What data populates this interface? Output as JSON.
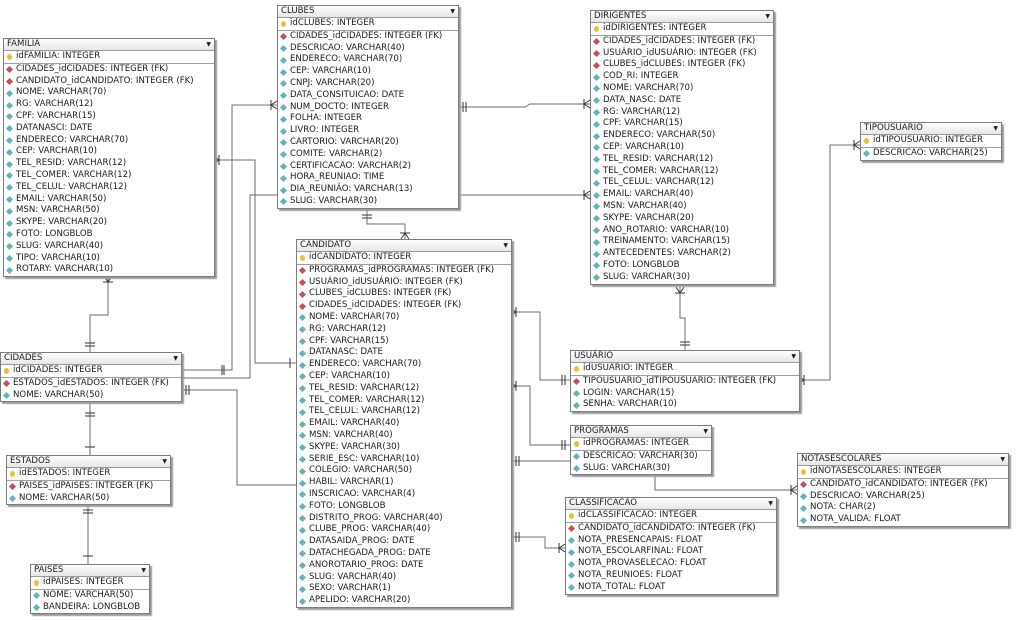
{
  "colors": {
    "primary_key": "#e3c23c",
    "foreign_key": "#c2505a",
    "column": "#69b1b8",
    "line": "#6e6e6e"
  },
  "tables": [
    {
      "id": "familia",
      "name": "FAMILIA",
      "fields": [
        {
          "text": "idFAMILIA: INTEGER",
          "key": "pk"
        },
        {
          "text": "CIDADES_idCIDADES: INTEGER (FK)",
          "key": "fk"
        },
        {
          "text": "CANDIDATO_idCANDIDATO: INTEGER (FK)",
          "key": "fk"
        },
        {
          "text": "NOME: VARCHAR(70)",
          "key": "col"
        },
        {
          "text": "RG: VARCHAR(12)",
          "key": "col"
        },
        {
          "text": "CPF: VARCHAR(15)",
          "key": "col"
        },
        {
          "text": "DATANASCI: DATE",
          "key": "col"
        },
        {
          "text": "ENDERECO: VARCHAR(70)",
          "key": "col"
        },
        {
          "text": "CEP: VARCHAR(10)",
          "key": "col"
        },
        {
          "text": "TEL_RESID: VARCHAR(12)",
          "key": "col"
        },
        {
          "text": "TEL_COMER: VARCHAR(12)",
          "key": "col"
        },
        {
          "text": "TEL_CELUL: VARCHAR(12)",
          "key": "col"
        },
        {
          "text": "EMAIL: VARCHAR(50)",
          "key": "col"
        },
        {
          "text": "MSN: VARCHAR(50)",
          "key": "col"
        },
        {
          "text": "SKYPE: VARCHAR(20)",
          "key": "col"
        },
        {
          "text": "FOTO: LONGBLOB",
          "key": "col"
        },
        {
          "text": "SLUG: VARCHAR(40)",
          "key": "col"
        },
        {
          "text": "TIPO: VARCHAR(10)",
          "key": "col"
        },
        {
          "text": "ROTARY: VARCHAR(10)",
          "key": "col"
        }
      ]
    },
    {
      "id": "clubes",
      "name": "CLUBES",
      "fields": [
        {
          "text": "idCLUBES: INTEGER",
          "key": "pk"
        },
        {
          "text": "CIDADES_idCIDADES: INTEGER (FK)",
          "key": "fk"
        },
        {
          "text": "DESCRICAO: VARCHAR(40)",
          "key": "col"
        },
        {
          "text": "ENDERECO: VARCHAR(70)",
          "key": "col"
        },
        {
          "text": "CEP: VARCHAR(10)",
          "key": "col"
        },
        {
          "text": "CNPJ: VARCHAR(20)",
          "key": "col"
        },
        {
          "text": "DATA_CONSITUICAO: DATE",
          "key": "col"
        },
        {
          "text": "NUM_DOCTO: INTEGER",
          "key": "col"
        },
        {
          "text": "FOLHA: INTEGER",
          "key": "col"
        },
        {
          "text": "LIVRO: INTEGER",
          "key": "col"
        },
        {
          "text": "CARTORIO: VARCHAR(20)",
          "key": "col"
        },
        {
          "text": "COMITE: VARCHAR(2)",
          "key": "col"
        },
        {
          "text": "CERTIFICACAO: VARCHAR(2)",
          "key": "col"
        },
        {
          "text": "HORA_REUNIAO: TIME",
          "key": "col"
        },
        {
          "text": "DIA_REUNIÃO: VARCHAR(13)",
          "key": "col"
        },
        {
          "text": "SLUG: VARCHAR(30)",
          "key": "col"
        }
      ]
    },
    {
      "id": "dirigentes",
      "name": "DIRIGENTES",
      "fields": [
        {
          "text": "idDIRIGENTES: INTEGER",
          "key": "pk"
        },
        {
          "text": "CIDADES_idCIDADES: INTEGER (FK)",
          "key": "fk"
        },
        {
          "text": "USUÁRIO_idUSUÁRIO: INTEGER (FK)",
          "key": "fk"
        },
        {
          "text": "CLUBES_idCLUBES: INTEGER (FK)",
          "key": "fk"
        },
        {
          "text": "COD_RI: INTEGER",
          "key": "col"
        },
        {
          "text": "NOME: VARCHAR(70)",
          "key": "col"
        },
        {
          "text": "DATA_NASC: DATE",
          "key": "col"
        },
        {
          "text": "RG: VARCHAR(12)",
          "key": "col"
        },
        {
          "text": "CPF: VARCHAR(15)",
          "key": "col"
        },
        {
          "text": "ENDERECO: VARCHAR(50)",
          "key": "col"
        },
        {
          "text": "CEP: VARCHAR(10)",
          "key": "col"
        },
        {
          "text": "TEL_RESID: VARCHAR(12)",
          "key": "col"
        },
        {
          "text": "TEL_COMER: VARCHAR(12)",
          "key": "col"
        },
        {
          "text": "TEL_CELUL: VARCHAR(12)",
          "key": "col"
        },
        {
          "text": "EMAIL: VARCHAR(40)",
          "key": "col"
        },
        {
          "text": "MSN: VARCHAR(40)",
          "key": "col"
        },
        {
          "text": "SKYPE: VARCHAR(20)",
          "key": "col"
        },
        {
          "text": "ANO_ROTARIO: VARCHAR(10)",
          "key": "col"
        },
        {
          "text": "TREINAMENTO: VARCHAR(15)",
          "key": "col"
        },
        {
          "text": "ANTECEDENTES: VARCHAR(2)",
          "key": "col"
        },
        {
          "text": "FOTO: LONGBLOB",
          "key": "col"
        },
        {
          "text": "SLUG: VARCHAR(30)",
          "key": "col"
        }
      ]
    },
    {
      "id": "tipousuario",
      "name": "TIPOUSUARIO",
      "fields": [
        {
          "text": "idTIPOUSUARIO: INTEGER",
          "key": "pk"
        },
        {
          "text": "DESCRICAO: VARCHAR(25)",
          "key": "col"
        }
      ]
    },
    {
      "id": "candidato",
      "name": "CANDIDATO",
      "fields": [
        {
          "text": "idCANDIDATO: INTEGER",
          "key": "pk"
        },
        {
          "text": "PROGRAMAS_idPROGRAMAS: INTEGER (FK)",
          "key": "fk"
        },
        {
          "text": "USUÁRIO_idUSUÁRIO: INTEGER (FK)",
          "key": "fk"
        },
        {
          "text": "CLUBES_idCLUBES: INTEGER (FK)",
          "key": "fk"
        },
        {
          "text": "CIDADES_idCIDADES: INTEGER (FK)",
          "key": "fk"
        },
        {
          "text": "NOME: VARCHAR(70)",
          "key": "col"
        },
        {
          "text": "RG: VARCHAR(12)",
          "key": "col"
        },
        {
          "text": "CPF: VARCHAR(15)",
          "key": "col"
        },
        {
          "text": "DATANASC: DATE",
          "key": "col"
        },
        {
          "text": "ENDERECO: VARCHAR(70)",
          "key": "col"
        },
        {
          "text": "CEP: VARCHAR(10)",
          "key": "col"
        },
        {
          "text": "TEL_RESID: VARCHAR(12)",
          "key": "col"
        },
        {
          "text": "TEL_COMER: VARCHAR(12)",
          "key": "col"
        },
        {
          "text": "TEL_CELUL: VARCHAR(12)",
          "key": "col"
        },
        {
          "text": "EMAIL: VARCHAR(40)",
          "key": "col"
        },
        {
          "text": "MSN: VARCHAR(40)",
          "key": "col"
        },
        {
          "text": "SKYPE: VARCHAR(30)",
          "key": "col"
        },
        {
          "text": "SERIE_ESC: VARCHAR(10)",
          "key": "col"
        },
        {
          "text": "COLEGIO: VARCHAR(50)",
          "key": "col"
        },
        {
          "text": "HABIL: VARCHAR(1)",
          "key": "col"
        },
        {
          "text": "INSCRICAO: VARCHAR(4)",
          "key": "col"
        },
        {
          "text": "FOTO: LONGBLOB",
          "key": "col"
        },
        {
          "text": "DISTRITO_PROG: VARCHAR(40)",
          "key": "col"
        },
        {
          "text": "CLUBE_PROG: VARCHAR(40)",
          "key": "col"
        },
        {
          "text": "DATASAIDA_PROG: DATE",
          "key": "col"
        },
        {
          "text": "DATACHEGADA_PROG: DATE",
          "key": "col"
        },
        {
          "text": "ANOROTARIO_PROG: DATE",
          "key": "col"
        },
        {
          "text": "SLUG: VARCHAR(40)",
          "key": "col"
        },
        {
          "text": "SEXO: VARCHAR(1)",
          "key": "col"
        },
        {
          "text": "APELIDO: VARCHAR(20)",
          "key": "col"
        }
      ]
    },
    {
      "id": "cidades",
      "name": "CIDADES",
      "fields": [
        {
          "text": "idCIDADES: INTEGER",
          "key": "pk"
        },
        {
          "text": "ESTADOS_idESTADOS: INTEGER (FK)",
          "key": "fk"
        },
        {
          "text": "NOME: VARCHAR(50)",
          "key": "col"
        }
      ]
    },
    {
      "id": "estados",
      "name": "ESTADOS",
      "fields": [
        {
          "text": "idESTADOS: INTEGER",
          "key": "pk"
        },
        {
          "text": "PAISES_idPAISES: INTEGER (FK)",
          "key": "fk"
        },
        {
          "text": "NOME: VARCHAR(50)",
          "key": "col"
        }
      ]
    },
    {
      "id": "paises",
      "name": "PAISES",
      "fields": [
        {
          "text": "idPAISES: INTEGER",
          "key": "pk"
        },
        {
          "text": "NOME: VARCHAR(50)",
          "key": "col"
        },
        {
          "text": "BANDEIRA: LONGBLOB",
          "key": "col"
        }
      ]
    },
    {
      "id": "usuario",
      "name": "USUÁRIO",
      "fields": [
        {
          "text": "idUSUÁRIO: INTEGER",
          "key": "pk"
        },
        {
          "text": "TIPOUSUARIO_idTIPOUSUARIO: INTEGER (FK)",
          "key": "fk"
        },
        {
          "text": "LOGIN: VARCHAR(15)",
          "key": "col"
        },
        {
          "text": "SENHA: VARCHAR(10)",
          "key": "col"
        }
      ]
    },
    {
      "id": "programas",
      "name": "PROGRAMAS",
      "fields": [
        {
          "text": "idPROGRAMAS: INTEGER",
          "key": "pk"
        },
        {
          "text": "DESCRICAO: VARCHAR(30)",
          "key": "col"
        },
        {
          "text": "SLUG: VARCHAR(30)",
          "key": "col"
        }
      ]
    },
    {
      "id": "notasescolares",
      "name": "NOTASESCOLARES",
      "fields": [
        {
          "text": "idNOTASESCOLARES: INTEGER",
          "key": "pk"
        },
        {
          "text": "CANDIDATO_idCANDIDATO: INTEGER (FK)",
          "key": "fk"
        },
        {
          "text": "DESCRICAO: VARCHAR(25)",
          "key": "col"
        },
        {
          "text": "NOTA: CHAR(2)",
          "key": "col"
        },
        {
          "text": "NOTA_VALIDA: FLOAT",
          "key": "col"
        }
      ]
    },
    {
      "id": "classificacao",
      "name": "CLASSIFICACAO",
      "fields": [
        {
          "text": "idCLASSIFICACAO: INTEGER",
          "key": "pk"
        },
        {
          "text": "CANDIDATO_idCANDIDATO: INTEGER (FK)",
          "key": "fk"
        },
        {
          "text": "NOTA_PRESENCAPAIS: FLOAT",
          "key": "col"
        },
        {
          "text": "NOTA_ESCOLARFINAL: FLOAT",
          "key": "col"
        },
        {
          "text": "NOTA_PROVASELECAO: FLOAT",
          "key": "col"
        },
        {
          "text": "NOTA_REUNIOES: FLOAT",
          "key": "col"
        },
        {
          "text": "NOTA_TOTAL: FLOAT",
          "key": "col"
        }
      ]
    }
  ]
}
